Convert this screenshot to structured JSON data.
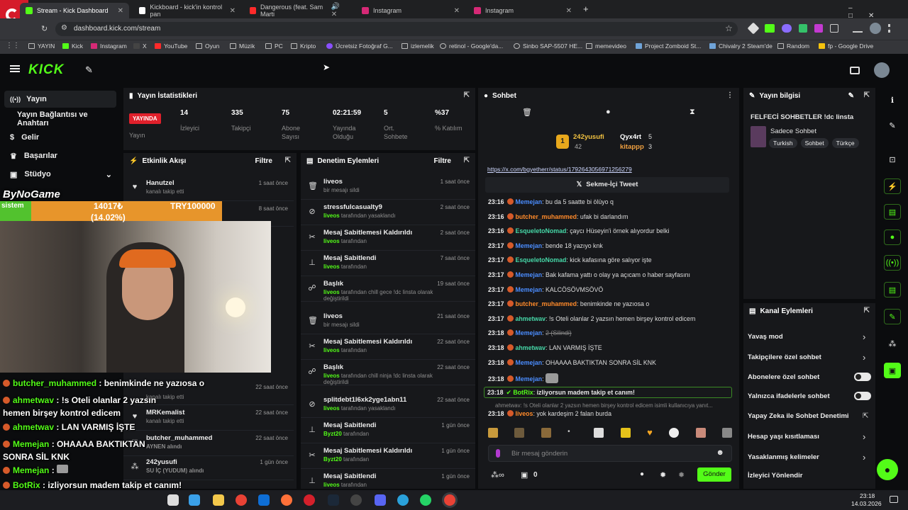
{
  "browser": {
    "tabs": [
      {
        "title": "Stream - Kick Dashboard",
        "active": true
      },
      {
        "title": "Kickboard - kick'in kontrol pan"
      },
      {
        "title": "Dangerous (feat. Sam Marti"
      },
      {
        "title": "Instagram"
      },
      {
        "title": "Instagram"
      }
    ],
    "url": "dashboard.kick.com/stream",
    "bookmarks": [
      "YAYIN",
      "Kick",
      "Instagram",
      "X",
      "YouTube",
      "Oyun",
      "Müzik",
      "PC",
      "Kripto",
      "Ücretsiz Fotoğraf G...",
      "izlemelik",
      "retinol - Google'da...",
      "Sinbo SAP-5507 HE...",
      "memevideo",
      "Project Zomboid St...",
      "Chivalry 2 Steam'de",
      "Random",
      "fp - Google Drive"
    ]
  },
  "kick": {
    "logo": "KICK",
    "sidebar": [
      "Yayın",
      "Yayın Bağlantısı ve Anahtarı",
      "Gelir",
      "Başarılar",
      "Stüdyo"
    ]
  },
  "stats": {
    "title": "Yayın İstatistikleri",
    "live_badge": "YAYINDA",
    "live_label": "Yayın",
    "items": [
      {
        "value": "14",
        "label": "İzleyici"
      },
      {
        "value": "335",
        "label": "Takipçi"
      },
      {
        "value": "75",
        "label": "Abone Sayısı"
      },
      {
        "value": "02:21:59",
        "label": "Yayında Olduğu"
      },
      {
        "value": "5",
        "label": "Ort. Sohbete"
      },
      {
        "value": "%37",
        "label": "% Katılım"
      }
    ]
  },
  "activity": {
    "title": "Etkinlik Akışı",
    "filter": "Filtre",
    "items": [
      {
        "user": "Hanutzel",
        "detail": "kanalı takip etti",
        "time": "1 saat önce"
      },
      {
        "user": "",
        "detail": "",
        "time": "8 saat önce"
      },
      {
        "user": "",
        "detail": "kanalı takip etti",
        "time": "22 saat önce"
      },
      {
        "user": "MRKemalist",
        "detail": "kanalı takip etti",
        "time": "22 saat önce"
      },
      {
        "user": "butcher_muhammed",
        "detail": "AYNEN alındı",
        "time": "22 saat önce"
      },
      {
        "user": "242yusufi",
        "detail": "SU İÇ (YUDUM) alındı",
        "time": "1 gün önce"
      }
    ]
  },
  "moderation": {
    "title": "Denetim Eylemleri",
    "filter": "Filtre",
    "items": [
      {
        "action": "liveos",
        "detail": "bir mesajı sildi",
        "time": "1 saat önce",
        "icon": "trash-icon"
      },
      {
        "action": "stressfulcasualty9",
        "by": "liveos",
        "detail": "tarafından yasaklandı",
        "time": "2 saat önce",
        "icon": "ban-icon"
      },
      {
        "action": "Mesaj Sabitlemesi Kaldırıldı",
        "by": "liveos",
        "detail": "tarafından",
        "time": "2 saat önce",
        "icon": "unpin-icon"
      },
      {
        "action": "Mesaj Sabitlendi",
        "by": "liveos",
        "detail": "tarafından",
        "time": "7 saat önce",
        "icon": "pin-icon"
      },
      {
        "action": "Başlık",
        "by": "liveos",
        "detail": "tarafından chill gece !dc linsta olarak değiştirildi",
        "time": "19 saat önce",
        "icon": "user-edit-icon"
      },
      {
        "action": "liveos",
        "detail": "bir mesajı sildi",
        "time": "21 saat önce",
        "icon": "trash-icon"
      },
      {
        "action": "Mesaj Sabitlemesi Kaldırıldı",
        "by": "liveos",
        "detail": "tarafından",
        "time": "22 saat önce",
        "icon": "unpin-icon"
      },
      {
        "action": "Başlık",
        "by": "liveos",
        "detail": "tarafından chill ninja !dc linsta olarak değiştirildi",
        "time": "22 saat önce",
        "icon": "user-edit-icon"
      },
      {
        "action": "splitdebt1l6xk2yge1abn11",
        "by": "liveos",
        "detail": "tarafından yasaklandı",
        "time": "22 saat önce",
        "icon": "ban-icon"
      },
      {
        "action": "Mesaj Sabitlendi",
        "by": "Byzt20",
        "detail": "tarafından",
        "time": "1 gün önce",
        "icon": "pin-icon"
      },
      {
        "action": "Mesaj Sabitlemesi Kaldırıldı",
        "by": "Byzt20",
        "detail": "tarafından",
        "time": "1 gün önce",
        "icon": "unpin-icon"
      },
      {
        "action": "Mesaj Sabitlendi",
        "by": "liveos",
        "detail": "tarafından",
        "time": "1 gün önce",
        "icon": "pin-icon"
      }
    ]
  },
  "chat": {
    "title": "Sohbet",
    "top": [
      {
        "name": "242yusufi",
        "count": "42"
      },
      {
        "name": "Qyx4rt",
        "count": "5"
      },
      {
        "name": "kitappp",
        "count": "3"
      }
    ],
    "link": "https://x.com/bgyetherr/status/1792643056971256279",
    "tweet": "Sekme-İçi Tweet",
    "messages": [
      {
        "time": "23:16",
        "user": "Memejan",
        "color": "#4b8dff",
        "text": "bu da 5 saatte bi ölüyo q"
      },
      {
        "time": "23:16",
        "user": "butcher_muhammed",
        "color": "#ff8a2a",
        "text": "ufak bi darlandım"
      },
      {
        "time": "23:16",
        "user": "EsqueletoNomad",
        "color": "#46d8a8",
        "text": "çaycı Hüseyin'i örnek alıyordur belki"
      },
      {
        "time": "23:17",
        "user": "Memejan",
        "color": "#4b8dff",
        "text": "bende 18 yazıyo knk"
      },
      {
        "time": "23:17",
        "user": "EsqueletoNomad",
        "color": "#46d8a8",
        "text": "kick kafasına göre salıyor işte"
      },
      {
        "time": "23:17",
        "user": "Memejan",
        "color": "#4b8dff",
        "text": "Bak kafama yattı o olay ya açıcam o haber sayfasını"
      },
      {
        "time": "23:17",
        "user": "Memejan",
        "color": "#4b8dff",
        "text": "KALCÖSÖVMSÖVÖ"
      },
      {
        "time": "23:17",
        "user": "butcher_muhammed",
        "color": "#ff8a2a",
        "text": "benimkinde ne yazıosa o"
      },
      {
        "time": "23:17",
        "user": "ahmetwav",
        "color": "#46d8a8",
        "text": "!s Oteli olanlar 2 yazsın hemen birşey kontrol edicem"
      },
      {
        "time": "23:18",
        "user": "Memejan",
        "color": "#4b8dff",
        "text": "2 (Silindi)"
      },
      {
        "time": "23:18",
        "user": "ahmetwav",
        "color": "#46d8a8",
        "text": "LAN VARMIŞ İŞTE"
      },
      {
        "time": "23:18",
        "user": "Memejan",
        "color": "#4b8dff",
        "text": "OHAAAA BAKTIKTAN SONRA SİL KNK"
      },
      {
        "time": "23:18",
        "user": "Memejan",
        "color": "#4b8dff",
        "text": ""
      }
    ],
    "bot": {
      "time": "23:18",
      "user": "BotRix",
      "text": "izliyorsun madem takip et canım!"
    },
    "reply": "ahmetwav: !s Oteli olanlar 2 yazsın hemen birşey kontrol edicem isimli kullanıcıya yanıt...",
    "last": {
      "time": "23:18",
      "user": "liveos",
      "text": "yok kardeşim 2 falan burda"
    },
    "placeholder": "Bir mesaj gönderin",
    "send": "Gönder",
    "points": "0"
  },
  "info": {
    "title": "Yayın bilgisi",
    "stream_title": "FELFECİ SOHBETLER !dc linsta",
    "category": "Sadece Sohbet",
    "tags": [
      "Turkish",
      "Sohbet",
      "Türkçe"
    ]
  },
  "channel": {
    "title": "Kanal Eylemleri",
    "items": [
      {
        "label": "Yavaş mod",
        "kind": "arrow"
      },
      {
        "label": "Takipçilere özel sohbet",
        "kind": "arrow"
      },
      {
        "label": "Abonelere özel sohbet",
        "kind": "toggle"
      },
      {
        "label": "Yalnızca ifadelerle sohbet",
        "kind": "toggle"
      },
      {
        "label": "Yapay Zeka ile Sohbet Denetimi",
        "kind": "ext"
      },
      {
        "label": "Hesap yaşı kısıtlaması",
        "kind": "arrow"
      },
      {
        "label": "Yasaklanmış kelimeler",
        "kind": "arrow"
      },
      {
        "label": "İzleyici Yönlendir",
        "kind": "none"
      }
    ]
  },
  "overlay": {
    "brand": "ByNoGame",
    "goal_label": "sistem",
    "goal_value": "14017₺",
    "goal_percent_text": "(14.02%)",
    "goal_target": "TRY100000",
    "goal_fraction": 0.1402,
    "chat": [
      {
        "user": "butcher_muhammed",
        "text": "benimkinde ne yazıosa o"
      },
      {
        "user": "ahmetwav",
        "text": "!s Oteli olanlar 2 yazsın hemen birşey kontrol edicem"
      },
      {
        "user": "ahmetwav",
        "text": "LAN VARMIŞ İŞTE"
      },
      {
        "user": "Memejan",
        "text": "OHAAAA BAKTIKTAN SONRA SİL KNK"
      },
      {
        "user": "Memejan",
        "text": ""
      },
      {
        "user": "BotRix",
        "text": "izliyorsun madem takip et canım!"
      },
      {
        "user": "liveos",
        "text": "yok kardeşim 2 falan burda"
      }
    ]
  },
  "taskbar": {
    "time": "23:18",
    "date": "14.03.2026"
  }
}
